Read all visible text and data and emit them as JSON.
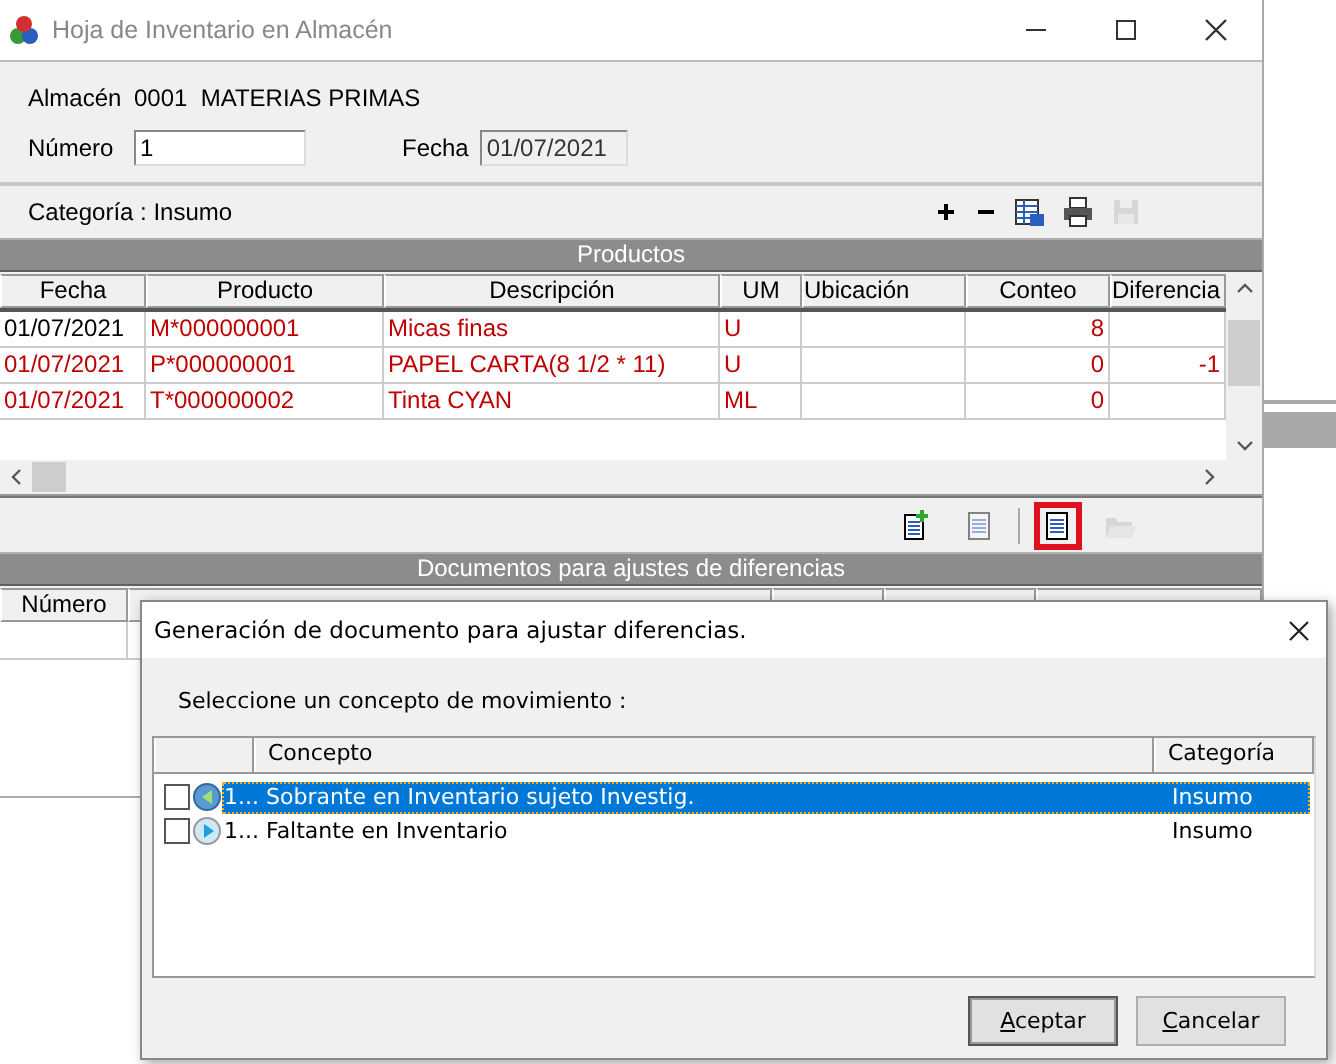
{
  "window": {
    "title": "Hoja de Inventario en Almacén"
  },
  "almacen": {
    "label": "Almacén",
    "value": "0001  MATERIAS PRIMAS"
  },
  "numero": {
    "label": "Número",
    "value": "1"
  },
  "fecha": {
    "label": "Fecha",
    "value": "01/07/2021",
    "disabled": true
  },
  "categoria": "Categoría : Insumo",
  "toolbar": [
    {
      "kind": "add",
      "disabled": false
    },
    {
      "kind": "remove",
      "disabled": false
    },
    {
      "kind": "export",
      "disabled": false
    },
    {
      "kind": "print",
      "disabled": false
    },
    {
      "kind": "save",
      "disabled": true
    }
  ],
  "productos": {
    "title": "Productos",
    "columns": [
      "Fecha",
      "Producto",
      "Descripción",
      "UM",
      "Ubicación",
      "Conteo",
      "Diferencia"
    ],
    "rows": [
      {
        "cells": [
          {
            "text": "01/07/2021",
            "color": "#000000"
          },
          {
            "text": "M*000000001",
            "color": "#c00000"
          },
          {
            "text": "Micas finas",
            "color": "#c00000"
          },
          {
            "text": "U",
            "color": "#c00000"
          },
          {},
          {
            "text": "8",
            "color": "#c00000"
          },
          {}
        ]
      },
      {
        "cells": [
          {
            "text": "01/07/2021",
            "color": "#c00000"
          },
          {
            "text": "P*000000001",
            "color": "#c00000"
          },
          {
            "text": "PAPEL CARTA(8 1/2 * 11)",
            "color": "#c00000"
          },
          {
            "text": "U",
            "color": "#c00000"
          },
          {},
          {
            "text": "0",
            "color": "#c00000"
          },
          {
            "text": "-1",
            "color": "#c00000"
          }
        ]
      },
      {
        "cells": [
          {
            "text": "01/07/2021",
            "color": "#c00000"
          },
          {
            "text": "T*000000002",
            "color": "#c00000"
          },
          {
            "text": "Tinta CYAN",
            "color": "#c00000"
          },
          {
            "text": "ML",
            "color": "#c00000"
          },
          {},
          {
            "text": "0",
            "color": "#c00000"
          },
          {}
        ]
      }
    ]
  },
  "doc_toolbar": [
    {
      "kind": "new",
      "disabled": false,
      "highlighted": false
    },
    {
      "kind": "doc",
      "disabled": true,
      "highlighted": false
    },
    {
      "kind": "doc",
      "disabled": false,
      "highlighted": true
    },
    {
      "kind": "open",
      "disabled": true,
      "highlighted": false
    }
  ],
  "documentos": {
    "title": "Documentos para ajustes de diferencias",
    "columns": [
      "Número"
    ]
  },
  "dialog": {
    "title": "Generación de documento para ajustar diferencias.",
    "prompt": "Seleccione un concepto de movimiento :",
    "columns": [
      "Concepto",
      "Categoría"
    ],
    "rows": [
      {
        "kind": "surplus",
        "checked": false,
        "selected": true,
        "code": "1...",
        "concept": "Sobrante en Inventario sujeto Investig.",
        "category": "Insumo"
      },
      {
        "kind": "shortage",
        "checked": false,
        "selected": false,
        "code": "1...",
        "concept": "Faltante en Inventario",
        "category": "Insumo"
      }
    ],
    "buttons": [
      "Aceptar",
      "Cancelar"
    ]
  }
}
